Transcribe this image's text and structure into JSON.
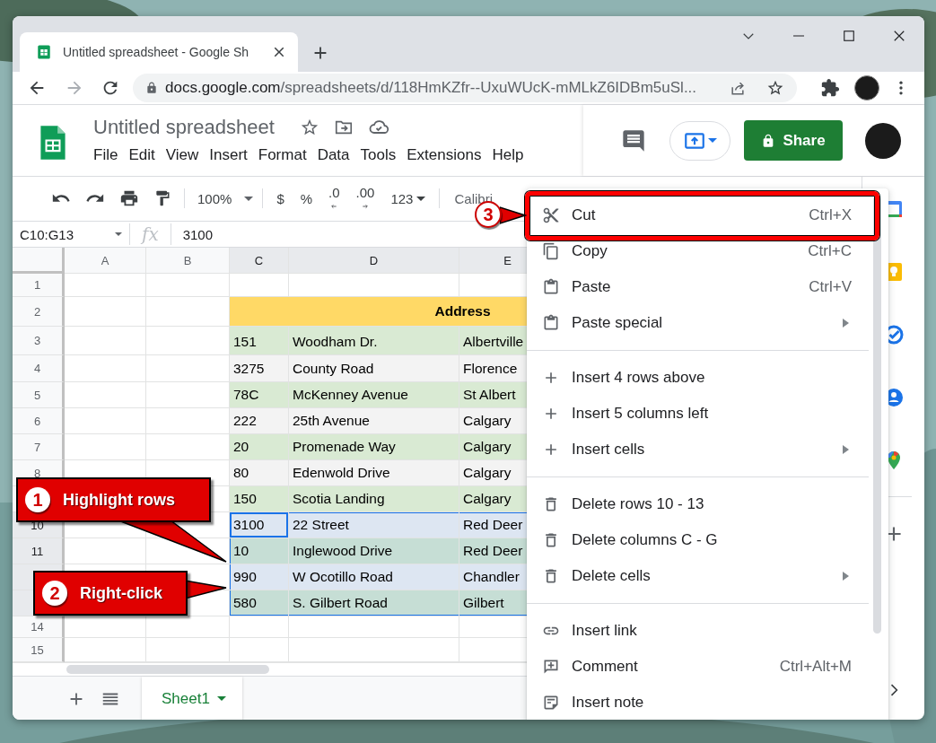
{
  "browser": {
    "tab_title": "Untitled spreadsheet - Google Sh",
    "url_host": "docs.google.com",
    "url_path": "/spreadsheets/d/118HmKZfr--UxuWUcK-mMLkZ6IDBm5uSl..."
  },
  "document": {
    "title": "Untitled spreadsheet",
    "menus": [
      "File",
      "Edit",
      "View",
      "Insert",
      "Format",
      "Data",
      "Tools",
      "Extensions",
      "Help"
    ],
    "share_label": "Share"
  },
  "toolbar": {
    "zoom": "100%",
    "format_buttons": [
      {
        "kind": "text",
        "label": "$"
      },
      {
        "kind": "text",
        "label": "%"
      },
      {
        "kind": "decrease",
        "label": ".0"
      },
      {
        "kind": "increase",
        "label": ".00"
      },
      {
        "kind": "dropdown",
        "label": "123"
      }
    ],
    "font": "Calibri"
  },
  "formula_bar": {
    "name_box": "C10:G13",
    "fx": "fx",
    "value": "3100"
  },
  "grid": {
    "columns": [
      {
        "label": "A",
        "selected": false
      },
      {
        "label": "B",
        "selected": false
      },
      {
        "label": "C",
        "selected": true
      },
      {
        "label": "D",
        "selected": true
      },
      {
        "label": "E",
        "selected": true
      }
    ],
    "rows": [
      {
        "number": "1",
        "kind": "data",
        "selected": false,
        "active": false
      },
      {
        "number": "2",
        "kind": "header",
        "color": "#ffd966",
        "selected": false,
        "active": false,
        "cells": [
          "Address"
        ]
      },
      {
        "number": "3",
        "kind": "data",
        "color": "#d9ead3",
        "selected": false,
        "active": false,
        "cells": [
          "151",
          "Woodham Dr.",
          "Albertville"
        ]
      },
      {
        "number": "4",
        "kind": "data",
        "color": "#f3f3f3",
        "selected": false,
        "active": false,
        "cells": [
          "3275",
          "County Road",
          "Florence"
        ]
      },
      {
        "number": "5",
        "kind": "data",
        "color": "#d9ead3",
        "selected": false,
        "active": false,
        "cells": [
          "78C",
          "McKenney Avenue",
          "St Albert"
        ]
      },
      {
        "number": "6",
        "kind": "data",
        "color": "#f3f3f3",
        "selected": false,
        "active": false,
        "cells": [
          "222",
          "25th Avenue",
          "Calgary"
        ]
      },
      {
        "number": "7",
        "kind": "data",
        "color": "#d9ead3",
        "selected": false,
        "active": false,
        "cells": [
          "20",
          "Promenade Way",
          "Calgary"
        ]
      },
      {
        "number": "8",
        "kind": "data",
        "color": "#f3f3f3",
        "selected": false,
        "active": false,
        "cells": [
          "80",
          "Edenwold Drive",
          "Calgary"
        ]
      },
      {
        "kind": "data",
        "color": "#d9ead3",
        "selected": false,
        "active": false,
        "cells": [
          "150",
          "Scotia Landing",
          "Calgary"
        ]
      },
      {
        "number": "10",
        "kind": "data",
        "color": "#dde6f2",
        "selected": true,
        "active": true,
        "cells": [
          "3100",
          "22 Street",
          "Red Deer"
        ]
      },
      {
        "number": "11",
        "kind": "data",
        "color": "#c6ded5",
        "selected": true,
        "active": false,
        "cells": [
          "10",
          "Inglewood Drive",
          "Red Deer"
        ]
      },
      {
        "kind": "data",
        "color": "#dde6f2",
        "selected": true,
        "active": false,
        "cells": [
          "990",
          "W Ocotillo Road",
          "Chandler"
        ]
      },
      {
        "kind": "data",
        "color": "#c6ded5",
        "selected": true,
        "active": false,
        "cells": [
          "580",
          "S. Gilbert Road",
          "Gilbert"
        ]
      },
      {
        "number": "14",
        "kind": "data",
        "selected": false,
        "active": false
      },
      {
        "number": "15",
        "kind": "data",
        "selected": false,
        "active": false
      }
    ]
  },
  "sheet_tabs": [
    {
      "label": "Sheet1",
      "selected": true
    }
  ],
  "context_menu": {
    "groups": [
      {
        "items": [
          {
            "kind": "cut",
            "label": "Cut",
            "shortcut": "Ctrl+X",
            "submenu": false
          },
          {
            "kind": "copy",
            "label": "Copy",
            "shortcut": "Ctrl+C",
            "submenu": false
          },
          {
            "kind": "paste",
            "label": "Paste",
            "shortcut": "Ctrl+V",
            "submenu": false
          },
          {
            "kind": "paste",
            "label": "Paste special",
            "submenu": true
          }
        ]
      },
      {
        "items": [
          {
            "kind": "insert",
            "label": "Insert 4 rows above",
            "submenu": false
          },
          {
            "kind": "insert",
            "label": "Insert 5 columns left",
            "submenu": false
          },
          {
            "kind": "insert",
            "label": "Insert cells",
            "submenu": true
          }
        ]
      },
      {
        "items": [
          {
            "kind": "delete",
            "label": "Delete rows 10 - 13",
            "submenu": false
          },
          {
            "kind": "delete",
            "label": "Delete columns C - G",
            "submenu": false
          },
          {
            "kind": "delete",
            "label": "Delete cells",
            "submenu": true
          }
        ]
      },
      {
        "items": [
          {
            "kind": "link",
            "label": "Insert link",
            "submenu": false
          },
          {
            "kind": "comment",
            "label": "Comment",
            "shortcut": "Ctrl+Alt+M",
            "submenu": false
          },
          {
            "kind": "note",
            "label": "Insert note",
            "submenu": false
          }
        ]
      }
    ]
  },
  "annotations": [
    {
      "kind": "callout",
      "number": "1",
      "text": "Highlight rows"
    },
    {
      "kind": "callout",
      "number": "2",
      "text": "Right-click"
    },
    {
      "kind": "frame",
      "number": "3"
    }
  ]
}
